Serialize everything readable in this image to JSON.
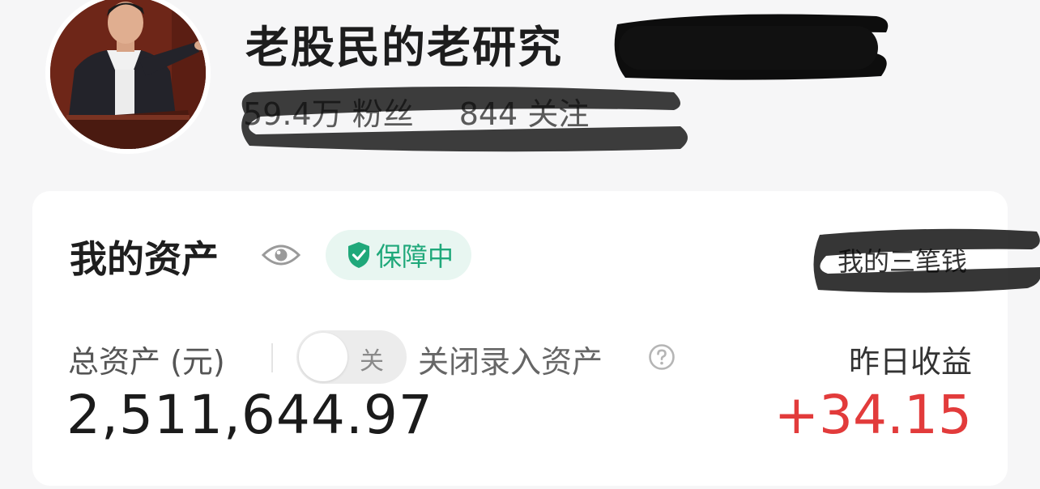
{
  "profile": {
    "name": "老股民的老研究",
    "fans": "59.4万 粉丝",
    "following": "844 关注"
  },
  "assets": {
    "title": "我的资产",
    "protection_badge": "保障中",
    "link_label": "我的三笔钱",
    "total_label": "总资产 (元)",
    "toggle_state": "关",
    "toggle_caption": "关闭录入资产",
    "total_value": "2,511,644.97",
    "yesterday_label": "昨日收益",
    "yesterday_value": "+34.15"
  },
  "colors": {
    "protect_green": "#1fa87a",
    "gain_red": "#e23b3b",
    "page_bg": "#f6f6f7"
  },
  "icons": {
    "eye": "eye-icon",
    "shield": "shield-check-icon",
    "help": "question-circle-icon"
  }
}
